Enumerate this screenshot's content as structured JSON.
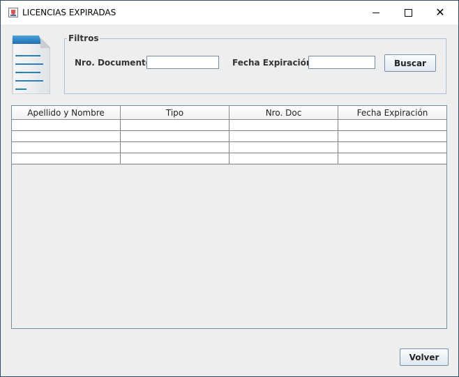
{
  "window": {
    "title": "LICENCIAS EXPIRADAS",
    "icon": "java-cup-icon",
    "controls": [
      "minimize-icon",
      "maximize-icon",
      "close-icon"
    ]
  },
  "filters": {
    "legend": "Filtros",
    "doc_label": "Nro. Documento",
    "doc_value": "",
    "fecha_label": "Fecha Expiración",
    "fecha_value": "",
    "search_button": "Buscar"
  },
  "table": {
    "columns": [
      "Apellido y Nombre",
      "Tipo",
      "Nro. Doc",
      "Fecha Expiración"
    ],
    "rows": [
      [
        "",
        "",
        "",
        ""
      ],
      [
        "",
        "",
        "",
        ""
      ],
      [
        "",
        "",
        "",
        ""
      ],
      [
        "",
        "",
        "",
        ""
      ]
    ]
  },
  "footer": {
    "back_button": "Volver"
  },
  "colors": {
    "window_bg": "#eeeeee",
    "group_border": "#a9c0d6",
    "accent_blue": "#2a7fc0"
  }
}
